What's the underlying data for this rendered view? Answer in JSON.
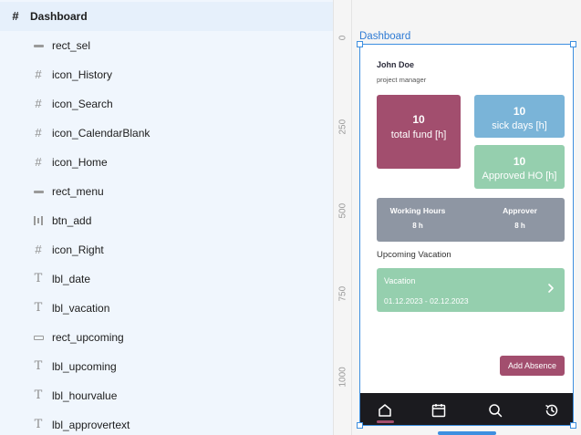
{
  "layers": {
    "top": "Dashboard",
    "items": [
      {
        "label": "rect_sel",
        "icon": "rect-icon"
      },
      {
        "label": "icon_History",
        "icon": "frame-icon"
      },
      {
        "label": "icon_Search",
        "icon": "frame-icon"
      },
      {
        "label": "icon_CalendarBlank",
        "icon": "frame-icon"
      },
      {
        "label": "icon_Home",
        "icon": "frame-icon"
      },
      {
        "label": "rect_menu",
        "icon": "rect-icon"
      },
      {
        "label": "btn_add",
        "icon": "button-icon"
      },
      {
        "label": "icon_Right",
        "icon": "frame-icon"
      },
      {
        "label": "lbl_date",
        "icon": "text-icon"
      },
      {
        "label": "lbl_vacation",
        "icon": "text-icon"
      },
      {
        "label": "rect_upcoming",
        "icon": "rect-outline-icon"
      },
      {
        "label": "lbl_upcoming",
        "icon": "text-icon"
      },
      {
        "label": "lbl_hourvalue",
        "icon": "text-icon"
      },
      {
        "label": "lbl_approvertext",
        "icon": "text-icon"
      }
    ]
  },
  "ruler": {
    "ticks": [
      "0",
      "250",
      "500",
      "750",
      "1000"
    ]
  },
  "canvas": {
    "frame_label": "Dashboard",
    "accent": "#3d8fe0"
  },
  "app": {
    "user_name": "John Doe",
    "user_role": "project manager",
    "total_fund": {
      "value": "10",
      "caption": "total fund [h]"
    },
    "sick_days": {
      "value": "10",
      "caption": "sick days [h]"
    },
    "approved_ho": {
      "value": "10",
      "caption": "Approved HO [h]"
    },
    "working_hours": {
      "label": "Working Hours",
      "value": "8 h"
    },
    "approver": {
      "label": "Approver",
      "value": "8 h"
    },
    "upcoming_label": "Upcoming Vacation",
    "vacation": {
      "title": "Vacation",
      "dates": "01.12.2023 - 02.12.2023"
    },
    "add_absence": "Add Absence",
    "tabs": [
      "home-icon",
      "calendar-icon",
      "search-icon",
      "history-icon"
    ],
    "colors": {
      "primary": "#a24e6e",
      "blue": "#7ab4d8",
      "green": "#95cfae",
      "grey": "#8e96a3",
      "tabbar": "#1b1b1f"
    }
  }
}
